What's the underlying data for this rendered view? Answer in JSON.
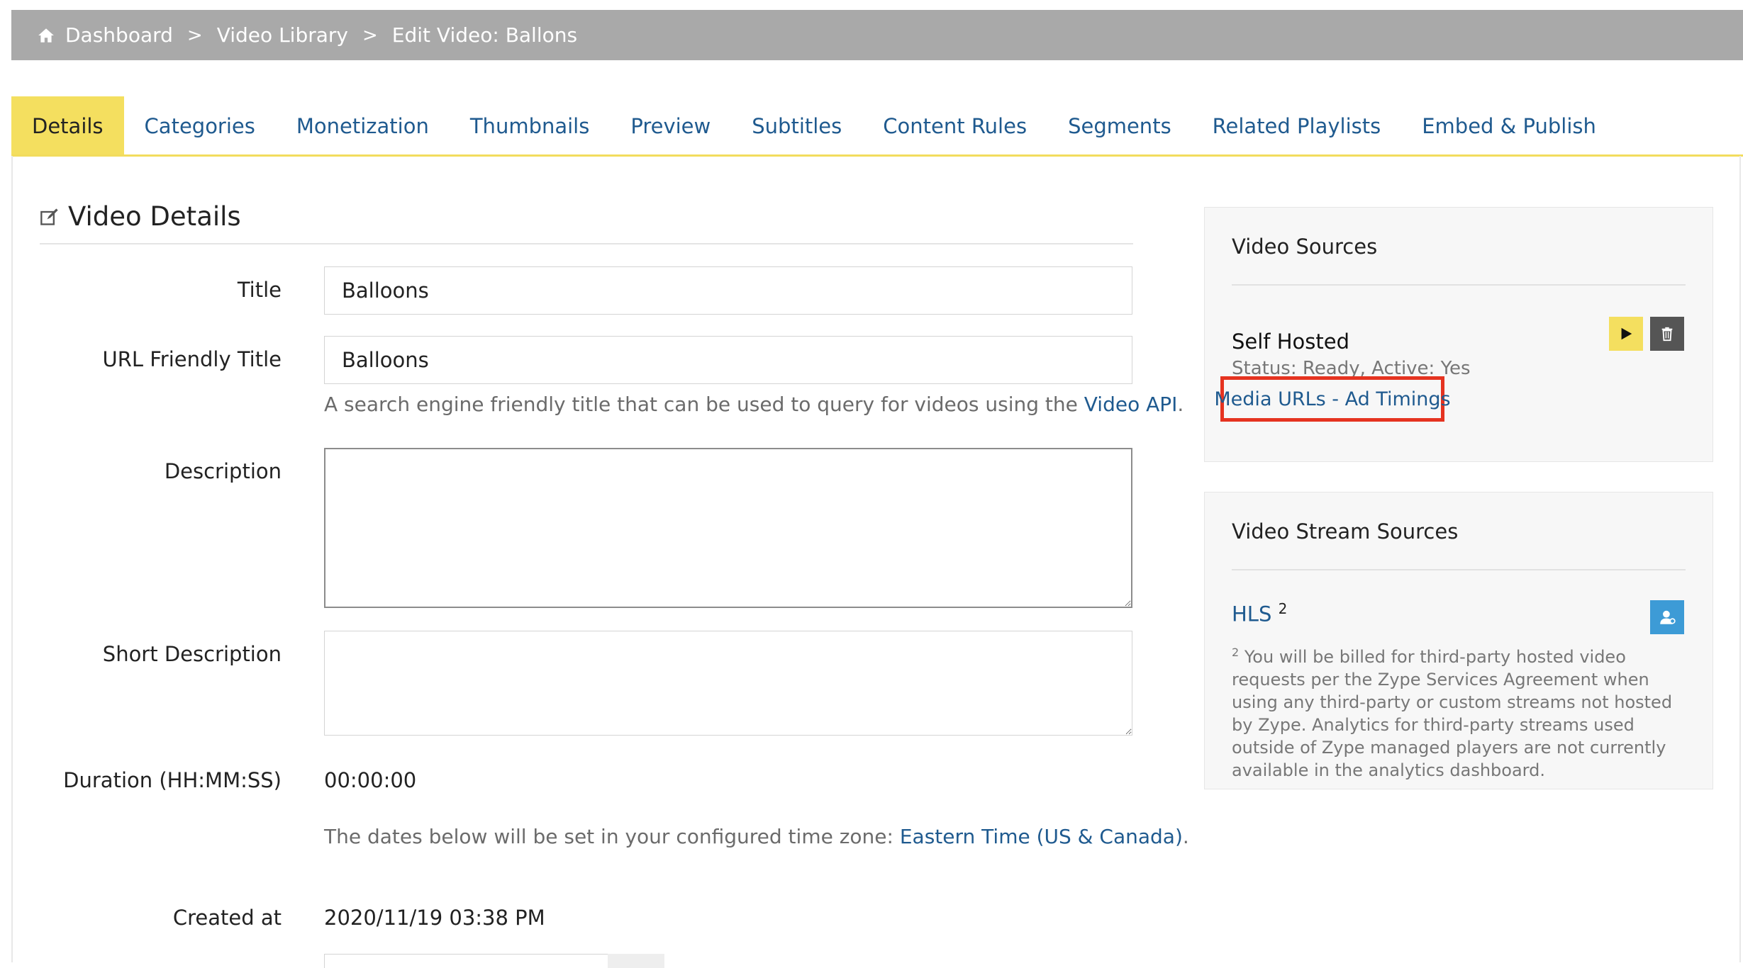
{
  "breadcrumb": {
    "home_icon": "home-icon",
    "items": [
      "Dashboard",
      "Video Library",
      "Edit Video: Ballons"
    ],
    "separator": ">"
  },
  "tabs": [
    {
      "label": "Details",
      "active": true
    },
    {
      "label": "Categories",
      "active": false
    },
    {
      "label": "Monetization",
      "active": false
    },
    {
      "label": "Thumbnails",
      "active": false
    },
    {
      "label": "Preview",
      "active": false
    },
    {
      "label": "Subtitles",
      "active": false
    },
    {
      "label": "Content Rules",
      "active": false
    },
    {
      "label": "Segments",
      "active": false
    },
    {
      "label": "Related Playlists",
      "active": false
    },
    {
      "label": "Embed & Publish",
      "active": false
    }
  ],
  "details": {
    "section_title": "Video Details",
    "edit_icon": "edit-icon",
    "title_label": "Title",
    "title_value": "Balloons",
    "url_title_label": "URL Friendly Title",
    "url_title_value": "Balloons",
    "url_help_text": "A search engine friendly title that can be used to query for videos using the ",
    "url_help_link": "Video API",
    "url_help_end": ".",
    "description_label": "Description",
    "description_value": "",
    "short_description_label": "Short Description",
    "short_description_value": "",
    "duration_label": "Duration (HH:MM:SS)",
    "duration_value": "00:00:00",
    "timezone_help_text": "The dates below will be set in your configured time zone: ",
    "timezone_link": "Eastern Time (US & Canada)",
    "timezone_help_end": ".",
    "created_label": "Created at",
    "created_value": "2020/11/19 03:38 PM"
  },
  "video_sources": {
    "title": "Video Sources",
    "source_name": "Self Hosted",
    "status": "Status: Ready, Active: Yes",
    "media_link": "Media URLs - Ad Timings",
    "play_icon": "play-icon",
    "trash_icon": "trash-icon"
  },
  "stream_sources": {
    "title": "Video Stream Sources",
    "hls_label": "HLS",
    "hls_sup": "2",
    "user_icon": "user-icon",
    "note_sup": "2",
    "note": " You will be billed for third-party hosted video requests per the Zype Services Agreement when using any third-party or custom streams not hosted by Zype. Analytics for third-party streams used outside of Zype managed players are not currently available in the analytics dashboard."
  },
  "colors": {
    "breadcrumb_bg": "#a9a9a9",
    "tab_active_bg": "#f4df5f",
    "link": "#1f5a8f",
    "highlight_border": "#e53320",
    "user_button": "#3d9bd6"
  }
}
